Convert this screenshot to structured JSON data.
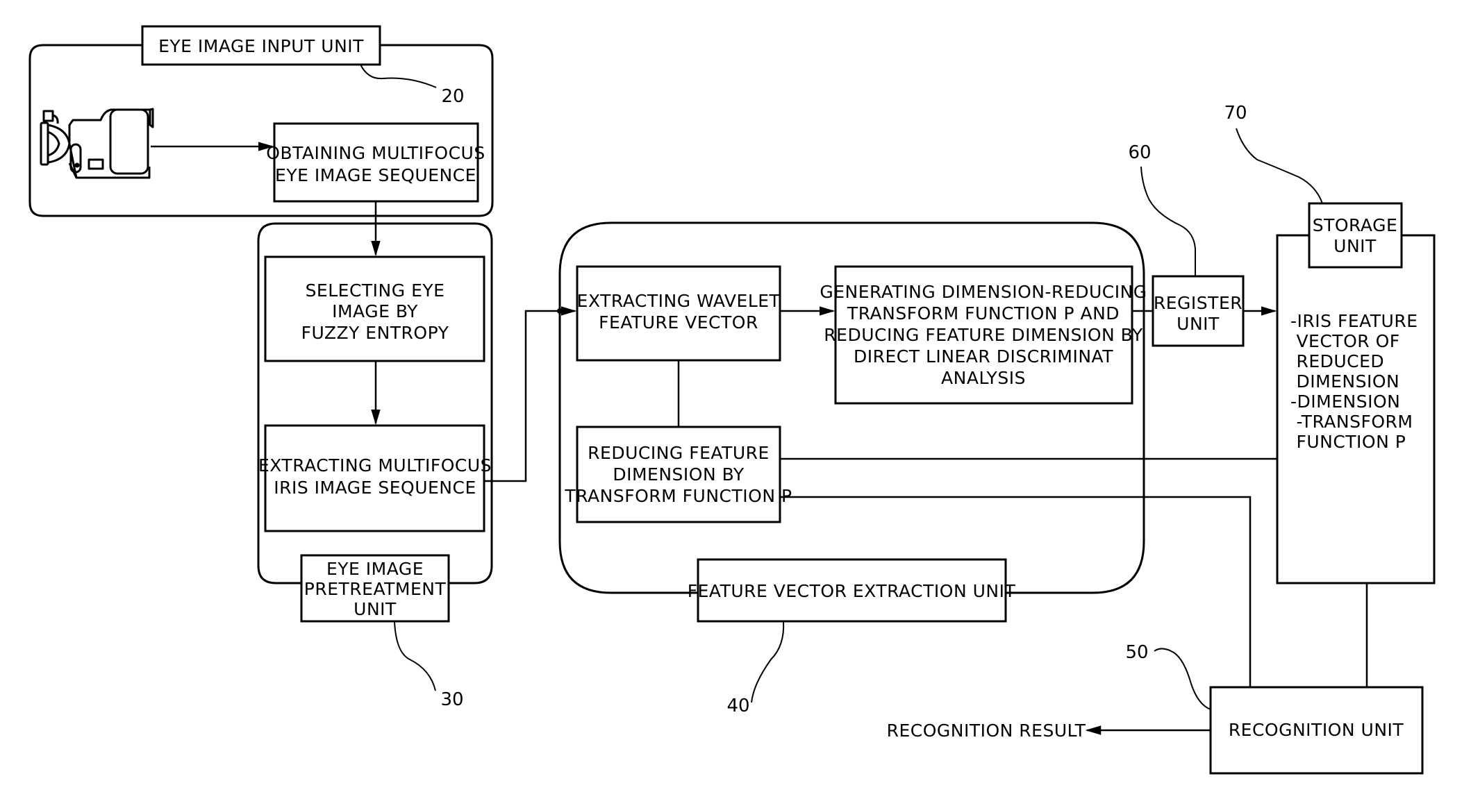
{
  "figure": {
    "type": "block-diagram",
    "subject": "iris recognition system"
  },
  "units": {
    "eye_image_input": {
      "label": "EYE IMAGE INPUT UNIT",
      "ref": "20",
      "device_icon": "video-camera-icon",
      "steps": [
        {
          "lines": [
            "OBTAINING MULTIFOCUS",
            "EYE IMAGE SEQUENCE"
          ]
        }
      ]
    },
    "pretreatment": {
      "label_lines": [
        "EYE IMAGE",
        "PRETREATMENT",
        "UNIT"
      ],
      "ref": "30",
      "steps": [
        {
          "lines": [
            "SELECTING EYE",
            "IMAGE BY",
            "FUZZY ENTROPY"
          ]
        },
        {
          "lines": [
            "EXTRACTING MULTIFOCUS",
            "IRIS IMAGE SEQUENCE"
          ]
        }
      ]
    },
    "feature_vector_extraction": {
      "label": "FEATURE VECTOR EXTRACTION UNIT",
      "ref": "40",
      "steps": [
        {
          "lines": [
            "EXTRACTING WAVELET",
            "FEATURE VECTOR"
          ]
        },
        {
          "lines": [
            "GENERATING DIMENSION-REDUCING",
            "TRANSFORM FUNCTION P AND",
            "REDUCING FEATURE DIMENSION BY",
            "DIRECT LINEAR DISCRIMINAT",
            "ANALYSIS"
          ]
        },
        {
          "lines": [
            "REDUCING FEATURE",
            "DIMENSION BY",
            "TRANSFORM FUNCTION P"
          ]
        }
      ]
    },
    "register": {
      "label_lines": [
        "REGISTER",
        "UNIT"
      ],
      "ref": "60"
    },
    "storage": {
      "label_lines": [
        "STORAGE",
        "UNIT"
      ],
      "ref": "70",
      "contents": [
        "-IRIS FEATURE",
        " VECTOR OF",
        " REDUCED",
        " DIMENSION",
        "-DIMENSION",
        " -TRANSFORM",
        " FUNCTION P"
      ]
    },
    "recognition": {
      "label": "RECOGNITION UNIT",
      "ref": "50",
      "output": "RECOGNITION RESULT"
    }
  }
}
